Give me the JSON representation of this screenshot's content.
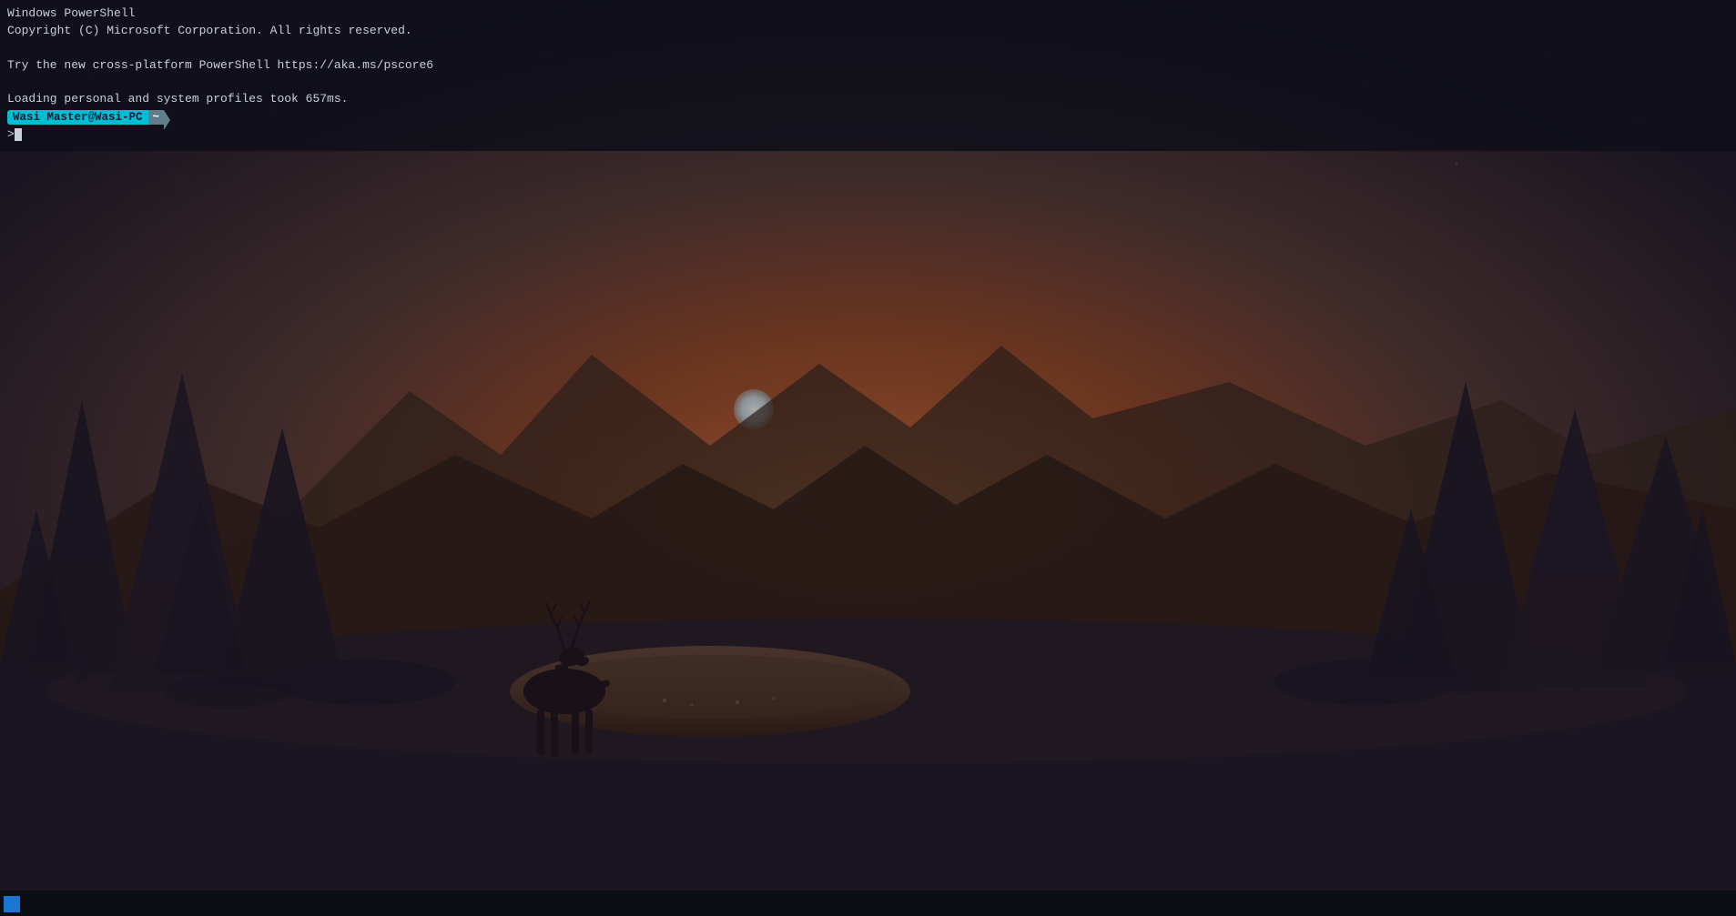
{
  "terminal": {
    "line1": "Windows PowerShell",
    "line2": "Copyright (C) Microsoft Corporation. All rights reserved.",
    "line3": "",
    "line4": "Try the new cross-platform PowerShell https://aka.ms/pscore6",
    "line5": "",
    "line6": "Loading personal and system profiles took 657ms.",
    "prompt_user": "Wasi Master@Wasi-PC",
    "prompt_tilde": "~",
    "prompt_symbol": ">",
    "cursor_line": ">"
  },
  "scene": {
    "description": "Sunset landscape with deer, lake, mountains, and pine trees silhouettes"
  },
  "taskbar": {
    "start_label": "Start"
  }
}
